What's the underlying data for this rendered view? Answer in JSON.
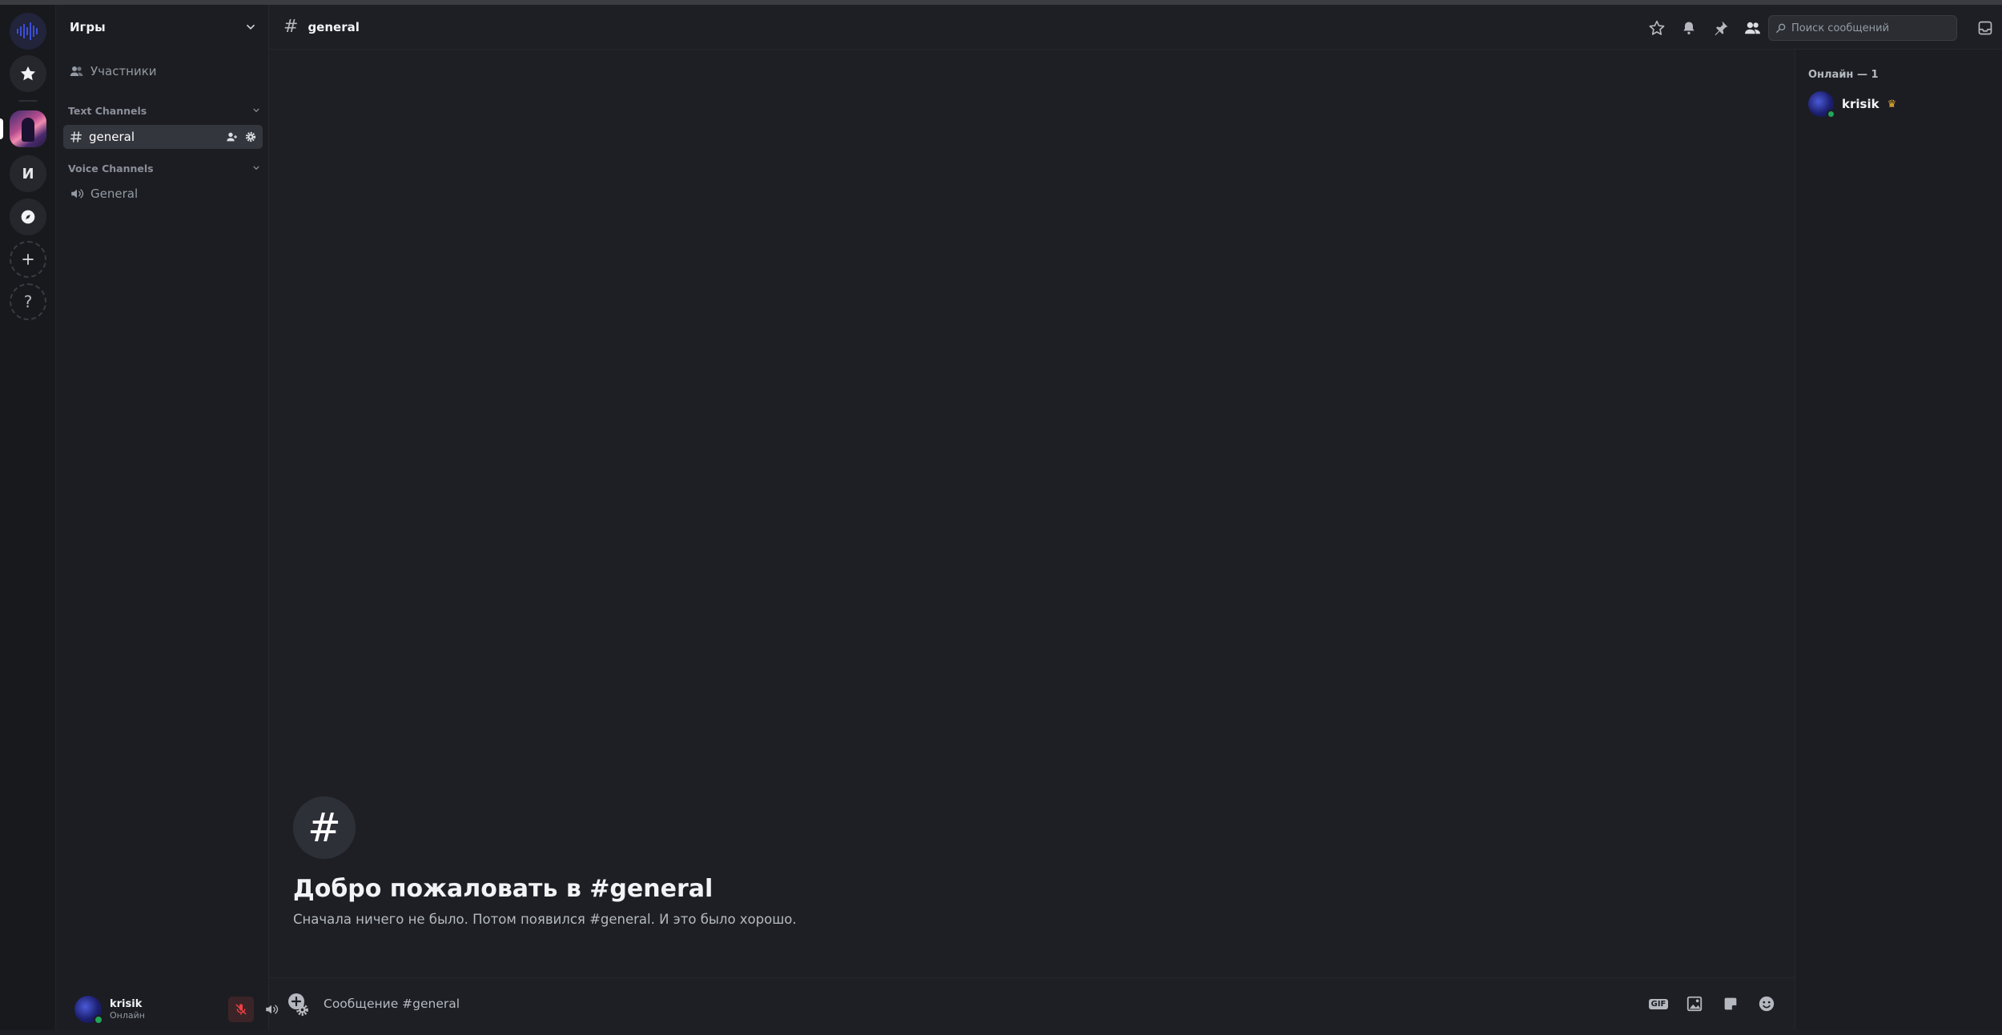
{
  "server": {
    "name": "Игры",
    "initial": "И",
    "members_link": "Участники"
  },
  "channels": {
    "text_category": "Text Channels",
    "voice_category": "Voice Channels",
    "text": [
      {
        "name": "general",
        "selected": true
      }
    ],
    "voice": [
      {
        "name": "General"
      }
    ]
  },
  "user": {
    "name": "krisik",
    "status": "Онлайн"
  },
  "header": {
    "channel": "general",
    "search_placeholder": "Поиск сообщений"
  },
  "welcome": {
    "title": "Добро пожаловать в #general",
    "subtitle": "Сначала ничего не было. Потом появился #general. И это было хорошо."
  },
  "composer": {
    "placeholder": "Сообщение #general",
    "gif_label": "GIF"
  },
  "members_panel": {
    "heading": "Онлайн — 1",
    "members": [
      {
        "name": "krisik",
        "owner": true,
        "status": "online"
      }
    ]
  },
  "colors": {
    "online": "#23a55a",
    "muted": "#f23f43",
    "crown": "#f0b232"
  }
}
